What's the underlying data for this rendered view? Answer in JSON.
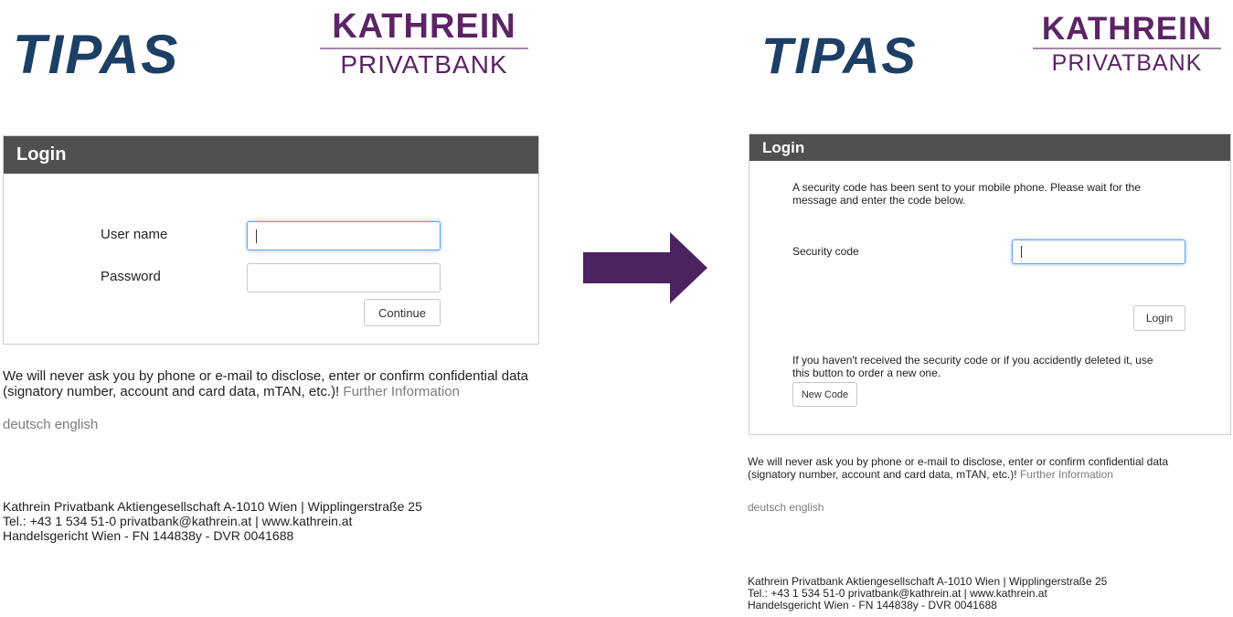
{
  "colors": {
    "tipas_blue": "#1c3f66",
    "kathrein_purple": "#5c2466",
    "panel_header": "#505050",
    "arrow": "#4b2361",
    "link_gray": "#7d7d7d"
  },
  "logos": {
    "tipas": "TIPAS",
    "kathrein_top": "KATHREIN",
    "kathrein_bottom": "PRIVATBANK"
  },
  "left": {
    "panel_title": "Login",
    "username_label": "User name",
    "password_label": "Password",
    "username_value": "",
    "password_value": "",
    "continue_button": "Continue",
    "notice_line1": "We will never ask you by phone or e-mail to disclose, enter or confirm confidential data",
    "notice_line2": "(signatory number, account and card data, mTAN, etc.)!",
    "further_info": "Further Information",
    "lang_de": "deutsch",
    "lang_en": "english",
    "footer_line1": "Kathrein Privatbank Aktiengesellschaft A-1010 Wien | Wipplingerstraße 25",
    "footer_line2": "Tel.: +43 1 534 51-0 privatbank@kathrein.at | www.kathrein.at",
    "footer_line3": "Handelsgericht Wien - FN 144838y - DVR 0041688"
  },
  "arrow_icon": "right-arrow-icon",
  "right": {
    "panel_title": "Login",
    "message_line1": "A security code has been sent to your mobile phone. Please wait for the",
    "message_line2": "message and enter the code below.",
    "security_label": "Security code",
    "security_value": "",
    "login_button": "Login",
    "resend_line1": "If you haven't received the security code or if you accidently deleted it, use",
    "resend_line2": "this button to order a new one.",
    "new_code_button": "New Code",
    "notice_line1": "We will never ask you by phone or e-mail to disclose, enter or confirm confidential data",
    "notice_line2": "(signatory number, account and card data, mTAN, etc.)!",
    "further_info": "Further Information",
    "lang_de": "deutsch",
    "lang_en": "english",
    "footer_line1": "Kathrein Privatbank Aktiengesellschaft A-1010 Wien | Wipplingerstraße 25",
    "footer_line2": "Tel.: +43 1 534 51-0 privatbank@kathrein.at | www.kathrein.at",
    "footer_line3": "Handelsgericht Wien - FN 144838y - DVR 0041688"
  }
}
